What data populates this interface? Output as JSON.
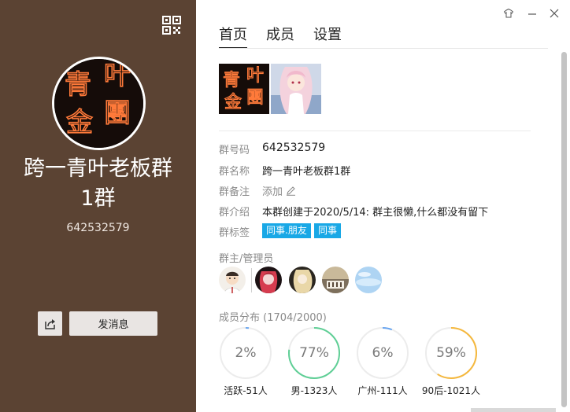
{
  "left_panel": {
    "avatar_text": [
      "青",
      "叶",
      "金",
      "團"
    ],
    "group_name": "跨一青叶老板群1群",
    "group_number": "642532579",
    "send_message_label": "发消息"
  },
  "tabs": [
    {
      "label": "首页",
      "active": true
    },
    {
      "label": "成员",
      "active": false
    },
    {
      "label": "设置",
      "active": false
    }
  ],
  "photo_text": [
    "青",
    "叶",
    "金",
    "團"
  ],
  "info": {
    "group_code_label": "群号码",
    "group_code_value": "642532579",
    "group_name_label": "群名称",
    "group_name_value": "跨一青叶老板群1群",
    "remark_label": "群备注",
    "remark_action": "添加",
    "intro_label": "群介绍",
    "intro_value": "本群创建于2020/5/14:  群主很懒,什么都没有留下",
    "tags_label": "群标签",
    "tags": [
      "同事.朋友",
      "同事"
    ]
  },
  "admins_title": "群主/管理员",
  "members": {
    "title": "成员分布",
    "count": "(1704/2000)",
    "stats": [
      {
        "percent": "2%",
        "fraction": 0.02,
        "label": "活跃-51人",
        "color": "#6aa6f0"
      },
      {
        "percent": "77%",
        "fraction": 0.77,
        "label": "男-1323人",
        "color": "#5fcf96"
      },
      {
        "percent": "6%",
        "fraction": 0.06,
        "label": "广州-111人",
        "color": "#6aa6f0"
      },
      {
        "percent": "59%",
        "fraction": 0.59,
        "label": "90后-1021人",
        "color": "#f5b83d"
      }
    ]
  },
  "colors": {
    "left_panel_bg": "#5b4333",
    "tag_bg": "#19a8e6",
    "neon_orange": "#ff7a3a"
  },
  "icons": {
    "qr": "qr-code-icon",
    "share": "share-icon",
    "edit": "pencil-icon",
    "skin": "skin-icon",
    "minimize": "minimize-icon",
    "close": "close-icon"
  }
}
